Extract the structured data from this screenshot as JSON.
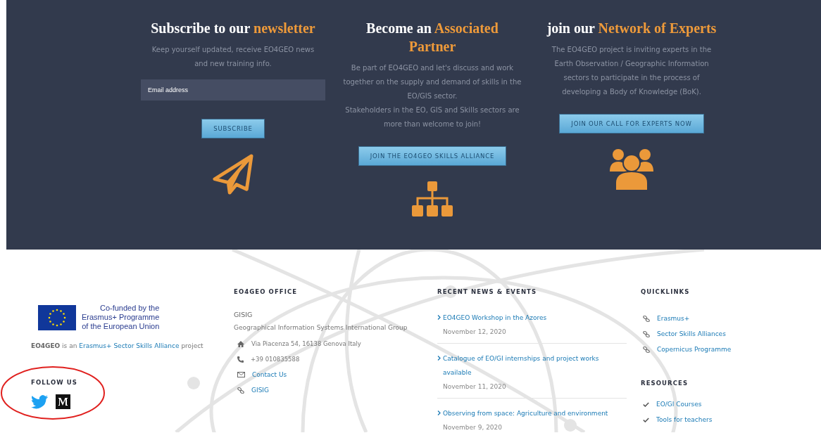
{
  "cta_panels": [
    {
      "title": "Subscribe to our",
      "title_highlight": "newsletter",
      "description": [
        "Keep yourself updated, receive EO4GEO news and new training info."
      ],
      "email_field": {
        "placeholder": "Email address"
      },
      "button": "SUBSCRIBE"
    },
    {
      "title": "Become an",
      "title_highlight": "Associated Partner",
      "description": [
        "Be part of EO4GEO and let's discuss and work together on the supply and demand of skills in the EO/GIS sector.",
        "Stakeholders in the EO, GIS and Skills sectors are more than welcome to join!"
      ],
      "button": "JOIN THE EO4GEO SKILLS ALLIANCE"
    },
    {
      "title": "join our",
      "title_highlight": "Network of Experts",
      "description": [
        "The EO4GEO project is inviting experts in the Earth Observation / Geographic Information sectors to participate in the process of developing a Body of Knowledge (BoK)."
      ],
      "button": "JOIN OUR CALL FOR EXPERTS NOW"
    }
  ],
  "footer": {
    "about": {
      "logo_text": [
        "Co-funded by the",
        "Erasmus+ Programme",
        "of the European Union"
      ],
      "project_name": "EO4GEO",
      "text_before_link": "is an",
      "link": "Erasmus+ Sector Skills Alliance",
      "text_after_link": "project",
      "follow_heading": "FOLLOW US"
    },
    "office": {
      "heading": "EO4GEO OFFICE",
      "org_short": "GISIG",
      "org_name": "Geographical Information Systems International Group",
      "items": [
        {
          "kind": "address",
          "text": "Via Piacenza 54, 16138 Genova Italy"
        },
        {
          "kind": "phone",
          "text": "+39 010835588"
        },
        {
          "kind": "email",
          "text": "Contact Us"
        },
        {
          "kind": "website",
          "text": "GISIG"
        }
      ]
    },
    "news": {
      "heading": "RECENT NEWS & EVENTS",
      "items": [
        {
          "title": "EO4GEO Workshop in the Azores",
          "date": "November 12, 2020"
        },
        {
          "title": "Catalogue of EO/GI internships and project works available",
          "date": "November 11, 2020"
        },
        {
          "title": "Observing from space: Agriculture and environment",
          "date": "November 9, 2020"
        }
      ]
    },
    "quicklinks": {
      "heading": "QUICKLINKS",
      "items": [
        "Erasmus+",
        "Sector Skills Alliances",
        "Copernicus Programme"
      ]
    },
    "resources": {
      "heading": "RESOURCES",
      "items": [
        "EO/GI Courses",
        "Tools for teachers"
      ]
    }
  }
}
